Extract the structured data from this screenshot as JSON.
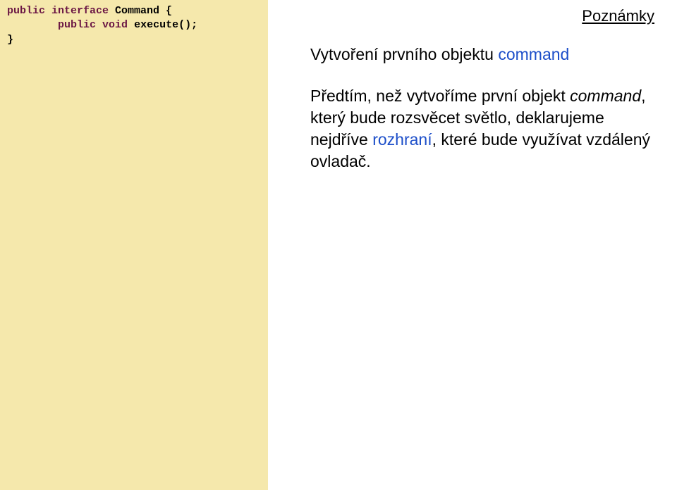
{
  "code": {
    "kw_public1": "public",
    "kw_interface": "interface",
    "class_name": " Command {",
    "indent": "        ",
    "kw_public2": "public",
    "kw_void": "void",
    "method": " execute();",
    "close": "}"
  },
  "right": {
    "notes_label": "Poznámky",
    "title_part1": "Vytvoření prvního objektu ",
    "title_highlight": "command",
    "body_leading": " Předtím, než vytvoříme první objekt ",
    "body_italic": "command",
    "body_mid": ", který bude rozsvěcet světlo, deklarujeme nejdříve ",
    "body_highlight": "rozhraní",
    "body_tail": ", které bude využívat vzdálený ovladač."
  }
}
